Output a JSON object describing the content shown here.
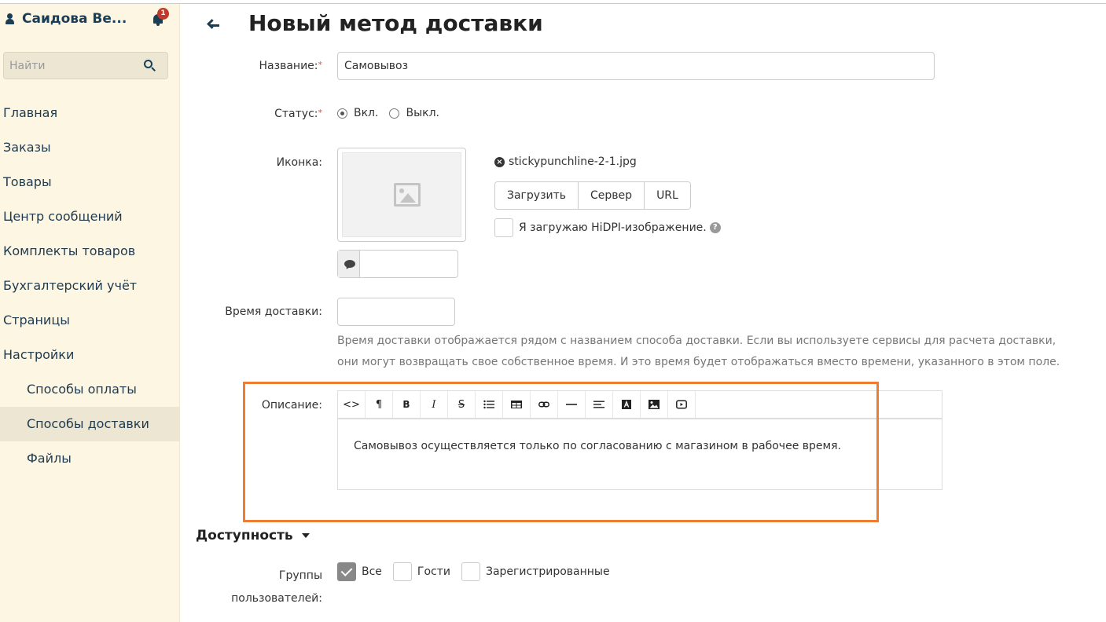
{
  "sidebar": {
    "user_name": "Саидова Ве...",
    "notification_count": "1",
    "search_placeholder": "Найти",
    "items": [
      {
        "label": "Главная"
      },
      {
        "label": "Заказы"
      },
      {
        "label": "Товары"
      },
      {
        "label": "Центр сообщений"
      },
      {
        "label": "Комплекты товаров"
      },
      {
        "label": "Бухгалтерский учёт"
      },
      {
        "label": "Страницы"
      },
      {
        "label": "Настройки"
      },
      {
        "label": "Способы оплаты"
      },
      {
        "label": "Способы доставки",
        "active": true
      },
      {
        "label": "Файлы"
      }
    ]
  },
  "page": {
    "title": "Новый метод доставки"
  },
  "form": {
    "name_label": "Название:",
    "required_mark": "*",
    "name_value": "Самовывоз",
    "status_label": "Статус:",
    "status_on": "Вкл.",
    "status_off": "Выкл.",
    "status_selected": "on",
    "icon_label": "Иконка:",
    "file_name": "stickypunchline-2-1.jpg",
    "remove_glyph": "×",
    "upload_buttons": {
      "upload": "Загрузить",
      "server": "Сервер",
      "url": "URL"
    },
    "hidpi_label": "Я загружаю HiDPI-изображение.",
    "help_glyph": "?",
    "delivery_time_label": "Время доставки:",
    "delivery_time_value": "",
    "delivery_time_hint": "Время доставки отображается рядом с названием способа доставки. Если вы используете сервисы для расчета доставки, они могут возвращать свое собственное время. И это время будет отображаться вместо времени, указанного в этом поле.",
    "description_label": "Описание:",
    "description_text": "Самовывоз осуществляется только по согласованию с магазином в рабочее время."
  },
  "editor_toolbar": {
    "html": "<>",
    "paragraph": "¶",
    "bold": "B",
    "italic": "I",
    "strike": "S"
  },
  "availability": {
    "title": "Доступность",
    "groups_label": "Группы пользователей:",
    "groups": [
      {
        "label": "Все",
        "checked": true
      },
      {
        "label": "Гости",
        "checked": false
      },
      {
        "label": "Зарегистрированные",
        "checked": false
      }
    ]
  },
  "colors": {
    "accent": "#1b3e57",
    "sidebar_bg": "#fdf6e3",
    "highlight": "#ed7d31",
    "badge": "#c0392b"
  }
}
